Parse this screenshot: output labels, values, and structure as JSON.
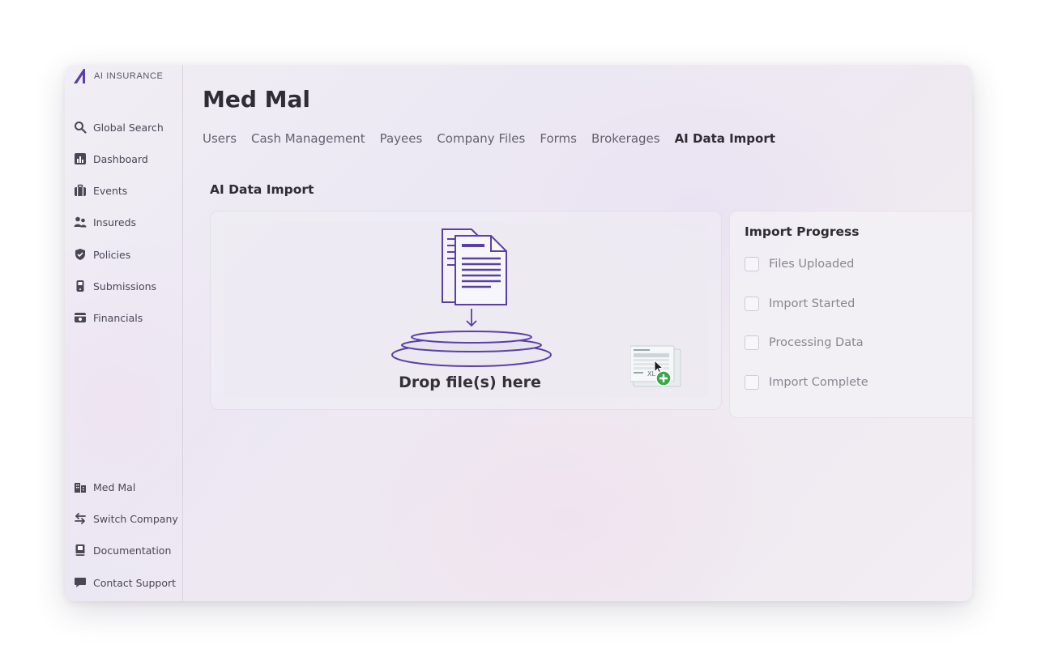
{
  "app": {
    "logo_text": "AI INSURANCE",
    "accent_color": "#5b3fa6"
  },
  "sidebar": {
    "top_items": [
      {
        "label": "Global Search",
        "icon": "search-icon"
      },
      {
        "label": "Dashboard",
        "icon": "chart-icon"
      },
      {
        "label": "Events",
        "icon": "briefcase-icon"
      },
      {
        "label": "Insureds",
        "icon": "users-icon"
      },
      {
        "label": "Policies",
        "icon": "shield-icon"
      },
      {
        "label": "Submissions",
        "icon": "phone-icon"
      },
      {
        "label": "Financials",
        "icon": "wallet-icon"
      }
    ],
    "bottom_items": [
      {
        "label": "Med Mal",
        "icon": "building-icon"
      },
      {
        "label": "Switch Company",
        "icon": "swap-icon"
      },
      {
        "label": "Documentation",
        "icon": "book-icon"
      },
      {
        "label": "Contact Support",
        "icon": "chat-icon"
      }
    ]
  },
  "header": {
    "title": "Med Mal",
    "tabs": [
      {
        "label": "Users"
      },
      {
        "label": "Cash Management"
      },
      {
        "label": "Payees"
      },
      {
        "label": "Company Files"
      },
      {
        "label": "Forms"
      },
      {
        "label": "Brokerages"
      },
      {
        "label": "AI Data Import",
        "active": true
      }
    ]
  },
  "import": {
    "section_title": "AI Data Import",
    "drop_label": "Drop file(s) here",
    "dragged_file_badge": "XL"
  },
  "progress": {
    "title": "Import Progress",
    "steps": [
      {
        "label": "Files Uploaded",
        "checked": false
      },
      {
        "label": "Import Started",
        "checked": false
      },
      {
        "label": "Processing Data",
        "checked": false
      },
      {
        "label": "Import Complete",
        "checked": false
      }
    ]
  }
}
